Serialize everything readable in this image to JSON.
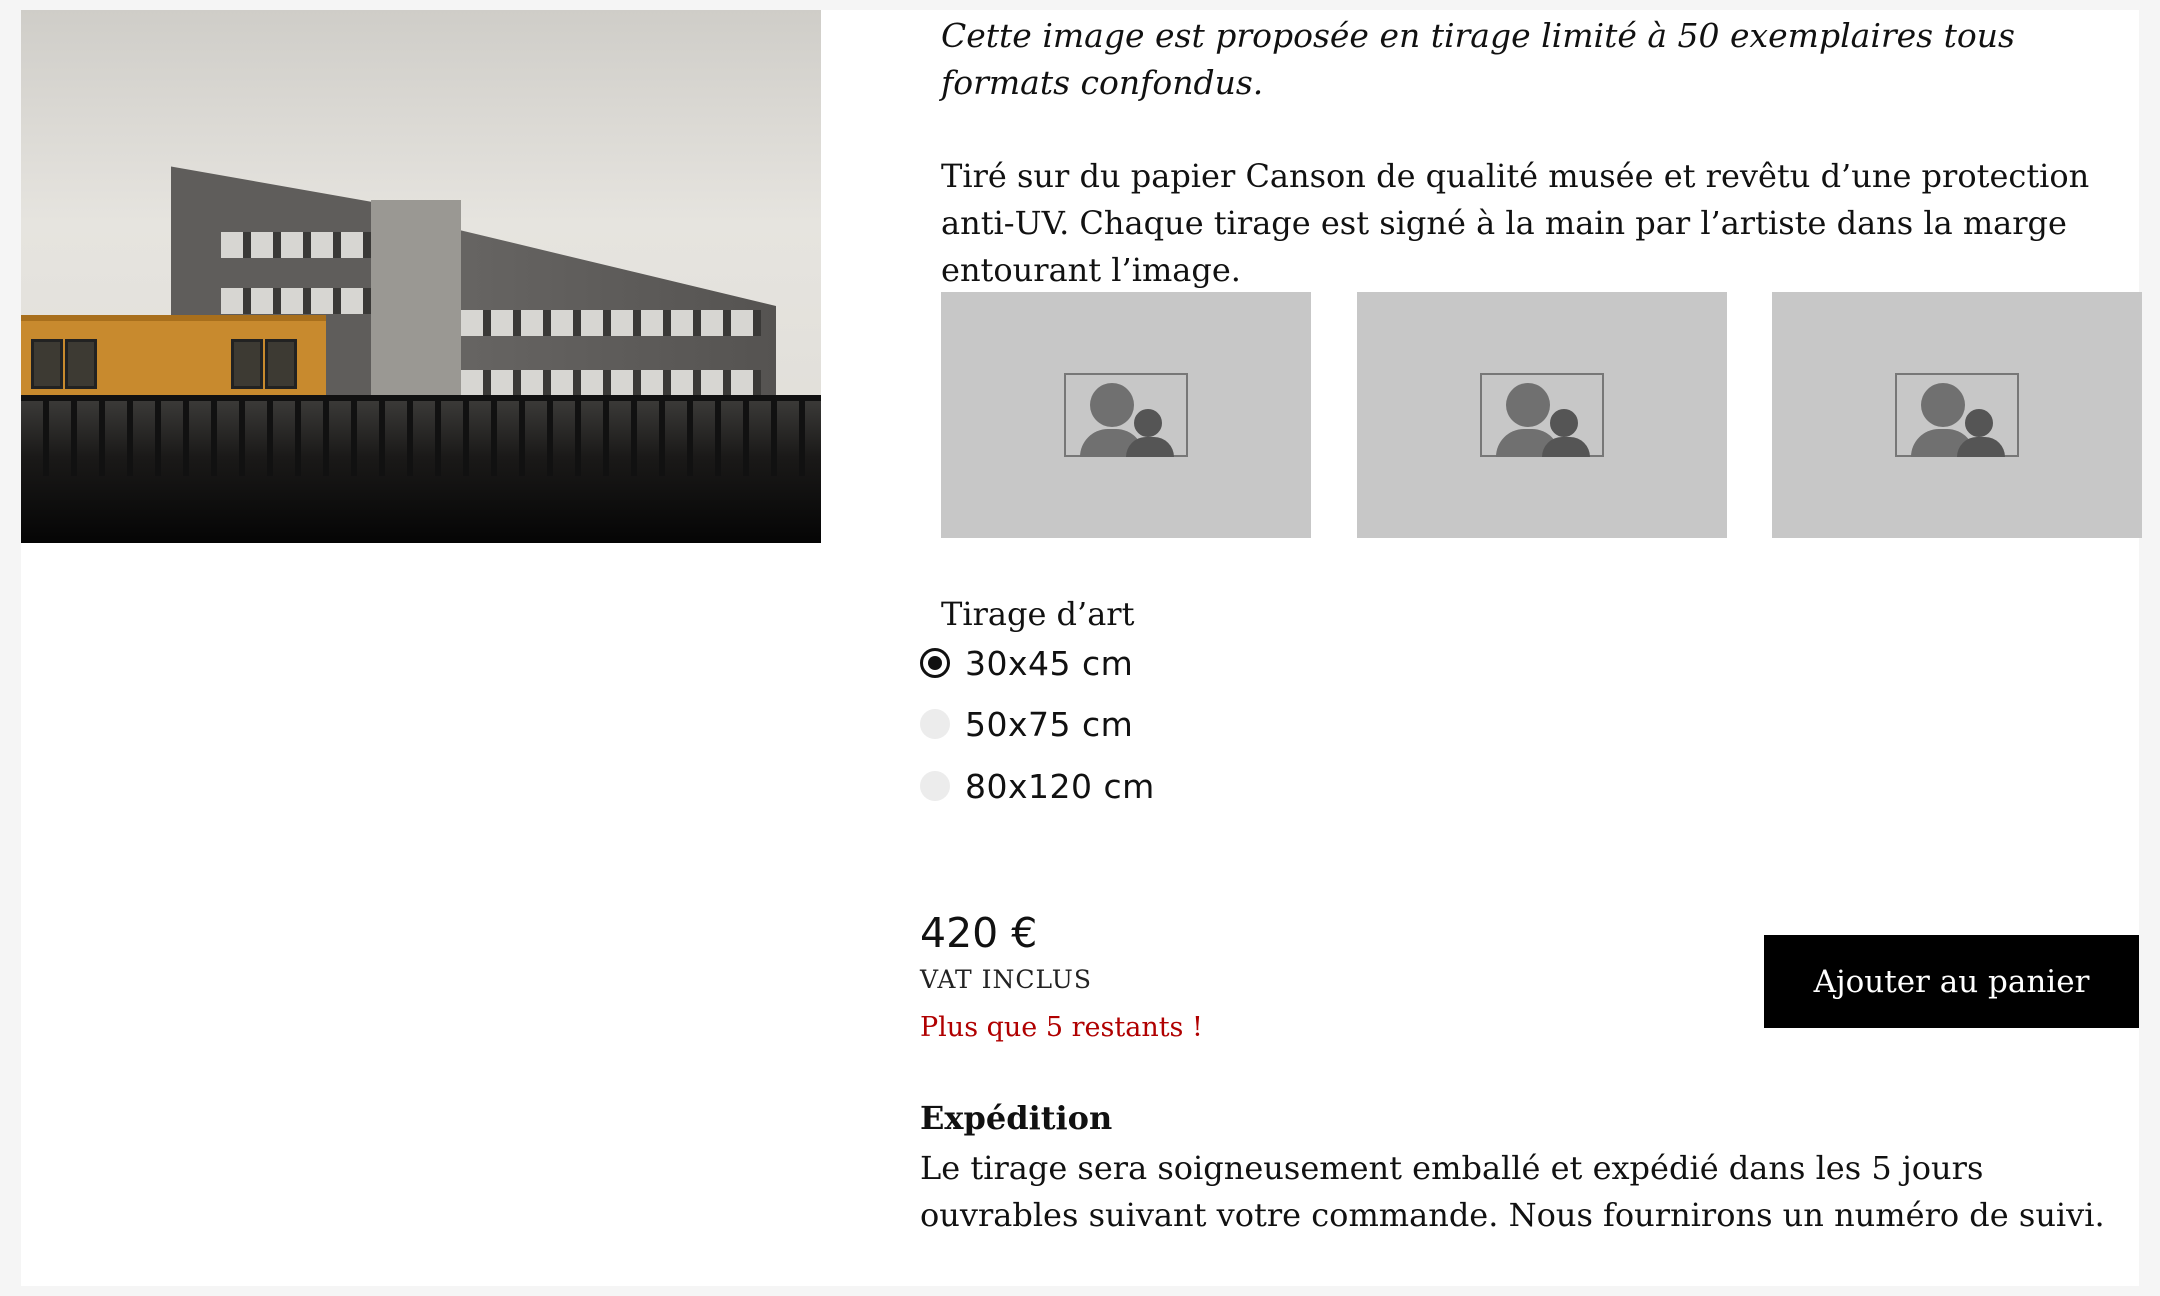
{
  "intro": {
    "limited_edition_text": "Cette image est proposée en tirage limité à 50 exemplaires tous formats confondus.",
    "paper_description": "Tiré sur du papier Canson de qualité musée et revêtu d’une protection anti-UV. Chaque tirage est signé à la main par l’artiste dans la marge entourant l’image."
  },
  "product_image": {
    "icon": "product-photo"
  },
  "thumbnails": [
    {
      "icon": "image-placeholder-icon"
    },
    {
      "icon": "image-placeholder-icon"
    },
    {
      "icon": "image-placeholder-icon"
    }
  ],
  "options": {
    "title": "Tirage d’art",
    "sizes": [
      {
        "label": "30x45 cm",
        "selected": true
      },
      {
        "label": "50x75 cm",
        "selected": false
      },
      {
        "label": "80x120 cm",
        "selected": false
      }
    ]
  },
  "pricing": {
    "price": "420 €",
    "vat_label": "VAT INCLUS",
    "stock_notice": "Plus que 5 restants !",
    "stock_color": "#b00000"
  },
  "cart": {
    "add_label": "Ajouter au panier"
  },
  "shipping": {
    "title": "Expédition",
    "text": "Le tirage sera soigneusement emballé et expédié dans les 5 jours ouvrables suivant votre commande. Nous fournirons un numéro de suivi."
  }
}
